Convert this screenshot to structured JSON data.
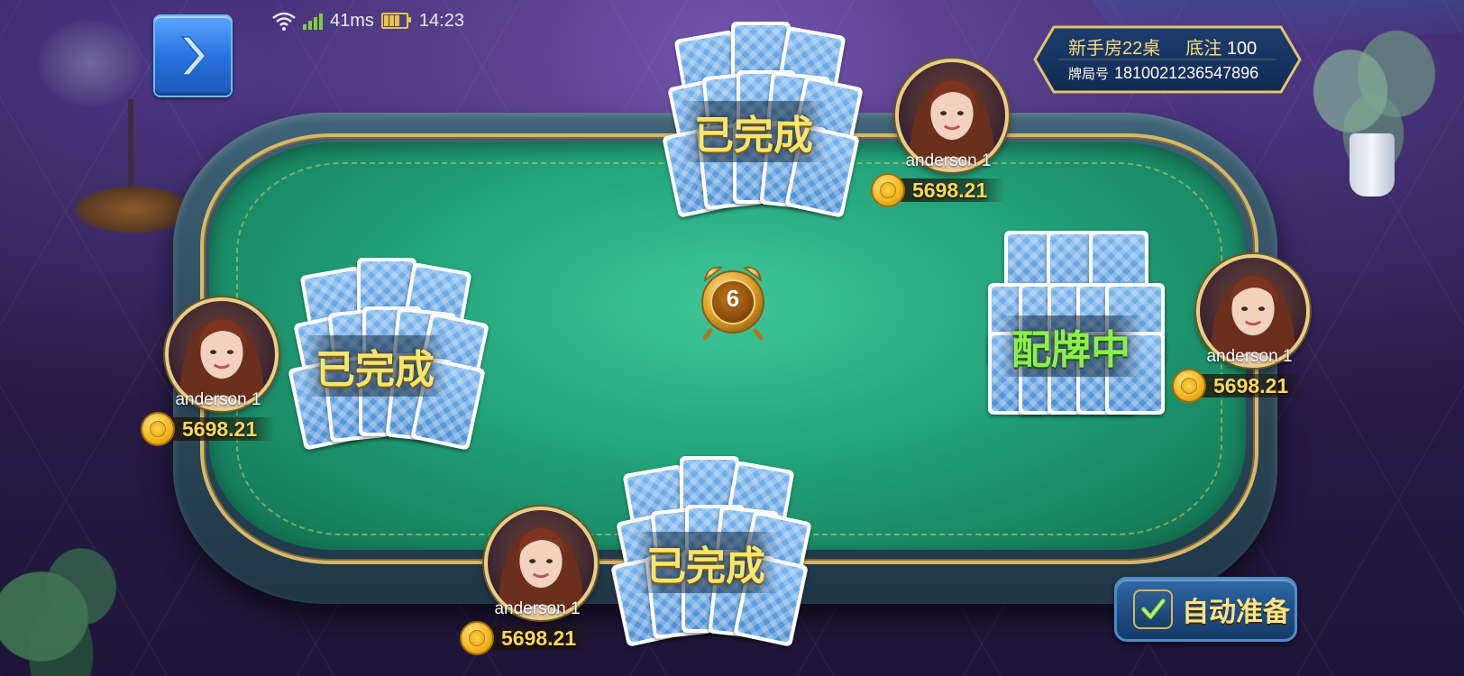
{
  "status_bar": {
    "ping": "41ms",
    "time": "14:23"
  },
  "room": {
    "name": "新手房22桌",
    "base_bet_label": "底注",
    "base_bet_value": "100",
    "game_id_label": "牌局号",
    "game_id": "1810021236547896"
  },
  "timer": {
    "count": "6"
  },
  "players": [
    {
      "seat": "top",
      "name": "anderson 1",
      "coins": "5698.21",
      "status": "已完成"
    },
    {
      "seat": "left",
      "name": "anderson 1",
      "coins": "5698.21",
      "status": "已完成"
    },
    {
      "seat": "right",
      "name": "anderson 1",
      "coins": "5698.21",
      "status": "配牌中"
    },
    {
      "seat": "bottom",
      "name": "anderson 1",
      "coins": "5698.21",
      "status": "已完成"
    }
  ],
  "auto_ready": {
    "label": "自动准备"
  },
  "icons": {
    "back": "chevron-right-icon",
    "wifi": "wifi-icon",
    "signal": "signal-icon",
    "battery": "battery-icon",
    "coin": "gold-coin-icon",
    "alarm": "alarm-clock-icon",
    "check": "checkmark-icon"
  },
  "colors": {
    "felt": "#22a37a",
    "gold_text": "#fbe56b",
    "green_status": "#8cf04a",
    "coin_text": "#ffd760"
  }
}
